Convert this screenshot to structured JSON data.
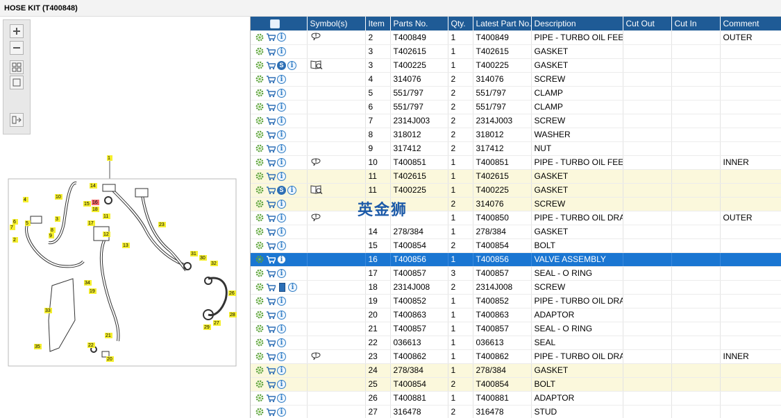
{
  "title": "HOSE KIT (T400848)",
  "toolbar": {
    "buttons": [
      {
        "name": "zoom-in-icon"
      },
      {
        "name": "zoom-out-icon"
      },
      {
        "name": "fit-icon"
      },
      {
        "name": "actual-size-icon"
      },
      {
        "name": "export-icon"
      }
    ]
  },
  "diagram": {
    "callouts": [
      "1",
      "4",
      "10",
      "14",
      "16",
      "15",
      "18",
      "17",
      "11",
      "23",
      "13",
      "5",
      "3",
      "8",
      "9",
      "7",
      "6",
      "2",
      "12",
      "31",
      "30",
      "32",
      "34",
      "19",
      "26",
      "33",
      "28",
      "27",
      "29",
      "21",
      "22",
      "35",
      "20"
    ]
  },
  "watermark": "英金狮",
  "table": {
    "headers": [
      "",
      "Symbol(s)",
      "Item",
      "Parts No.",
      "Qty.",
      "Latest Part No.",
      "Description",
      "Cut Out",
      "Cut In",
      "Comment"
    ],
    "rows": [
      {
        "icons": [
          "gear",
          "cart",
          "info"
        ],
        "symbol": "balloon",
        "item": "2",
        "parts": "T400849",
        "qty": "1",
        "latest": "T400849",
        "desc": "PIPE - TURBO OIL FEED",
        "comment": "OUTER",
        "style": ""
      },
      {
        "icons": [
          "gear",
          "cart",
          "info"
        ],
        "symbol": "",
        "item": "3",
        "parts": "T402615",
        "qty": "1",
        "latest": "T402615",
        "desc": "GASKET",
        "comment": "",
        "style": ""
      },
      {
        "icons": [
          "gear",
          "cart",
          "s",
          "info"
        ],
        "symbol": "book",
        "item": "3",
        "parts": "T400225",
        "qty": "1",
        "latest": "T400225",
        "desc": "GASKET",
        "comment": "",
        "style": ""
      },
      {
        "icons": [
          "gear",
          "cart",
          "info"
        ],
        "symbol": "",
        "item": "4",
        "parts": "314076",
        "qty": "2",
        "latest": "314076",
        "desc": "SCREW",
        "comment": "",
        "style": ""
      },
      {
        "icons": [
          "gear",
          "cart",
          "info"
        ],
        "symbol": "",
        "item": "5",
        "parts": "551/797",
        "qty": "2",
        "latest": "551/797",
        "desc": "CLAMP",
        "comment": "",
        "style": ""
      },
      {
        "icons": [
          "gear",
          "cart",
          "info"
        ],
        "symbol": "",
        "item": "6",
        "parts": "551/797",
        "qty": "2",
        "latest": "551/797",
        "desc": "CLAMP",
        "comment": "",
        "style": ""
      },
      {
        "icons": [
          "gear",
          "cart",
          "info"
        ],
        "symbol": "",
        "item": "7",
        "parts": "2314J003",
        "qty": "2",
        "latest": "2314J003",
        "desc": "SCREW",
        "comment": "",
        "style": ""
      },
      {
        "icons": [
          "gear",
          "cart",
          "info"
        ],
        "symbol": "",
        "item": "8",
        "parts": "318012",
        "qty": "2",
        "latest": "318012",
        "desc": "WASHER",
        "comment": "",
        "style": ""
      },
      {
        "icons": [
          "gear",
          "cart",
          "info"
        ],
        "symbol": "",
        "item": "9",
        "parts": "317412",
        "qty": "2",
        "latest": "317412",
        "desc": "NUT",
        "comment": "",
        "style": ""
      },
      {
        "icons": [
          "gear",
          "cart",
          "info"
        ],
        "symbol": "balloon",
        "item": "10",
        "parts": "T400851",
        "qty": "1",
        "latest": "T400851",
        "desc": "PIPE - TURBO OIL FEED",
        "comment": "INNER",
        "style": ""
      },
      {
        "icons": [
          "gear",
          "cart",
          "info"
        ],
        "symbol": "",
        "item": "11",
        "parts": "T402615",
        "qty": "1",
        "latest": "T402615",
        "desc": "GASKET",
        "comment": "",
        "style": "alt"
      },
      {
        "icons": [
          "gear",
          "cart",
          "s",
          "info"
        ],
        "symbol": "book",
        "item": "11",
        "parts": "T400225",
        "qty": "1",
        "latest": "T400225",
        "desc": "GASKET",
        "comment": "",
        "style": "alt"
      },
      {
        "icons": [
          "gear",
          "cart",
          "info"
        ],
        "symbol": "",
        "item": "",
        "parts": "",
        "qty": "2",
        "latest": "314076",
        "desc": "SCREW",
        "comment": "",
        "style": "alt"
      },
      {
        "icons": [
          "gear",
          "cart",
          "info"
        ],
        "symbol": "balloon",
        "item": "",
        "parts": "",
        "qty": "1",
        "latest": "T400850",
        "desc": "PIPE - TURBO OIL DRAIN",
        "comment": "OUTER",
        "style": ""
      },
      {
        "icons": [
          "gear",
          "cart",
          "info"
        ],
        "symbol": "",
        "item": "14",
        "parts": "278/384",
        "qty": "1",
        "latest": "278/384",
        "desc": "GASKET",
        "comment": "",
        "style": ""
      },
      {
        "icons": [
          "gear",
          "cart",
          "info"
        ],
        "symbol": "",
        "item": "15",
        "parts": "T400854",
        "qty": "2",
        "latest": "T400854",
        "desc": "BOLT",
        "comment": "",
        "style": ""
      },
      {
        "icons": [
          "gear",
          "cart",
          "info"
        ],
        "symbol": "",
        "item": "16",
        "parts": "T400856",
        "qty": "1",
        "latest": "T400856",
        "desc": "VALVE ASSEMBLY",
        "comment": "",
        "style": "selected"
      },
      {
        "icons": [
          "gear",
          "cart",
          "info"
        ],
        "symbol": "",
        "item": "17",
        "parts": "T400857",
        "qty": "3",
        "latest": "T400857",
        "desc": "SEAL - O RING",
        "comment": "",
        "style": ""
      },
      {
        "icons": [
          "gear",
          "cart",
          "book",
          "info"
        ],
        "symbol": "",
        "item": "18",
        "parts": "2314J008",
        "qty": "2",
        "latest": "2314J008",
        "desc": "SCREW",
        "comment": "",
        "style": ""
      },
      {
        "icons": [
          "gear",
          "cart",
          "info"
        ],
        "symbol": "",
        "item": "19",
        "parts": "T400852",
        "qty": "1",
        "latest": "T400852",
        "desc": "PIPE - TURBO OIL DRAIN",
        "comment": "",
        "style": ""
      },
      {
        "icons": [
          "gear",
          "cart",
          "info"
        ],
        "symbol": "",
        "item": "20",
        "parts": "T400863",
        "qty": "1",
        "latest": "T400863",
        "desc": "ADAPTOR",
        "comment": "",
        "style": ""
      },
      {
        "icons": [
          "gear",
          "cart",
          "info"
        ],
        "symbol": "",
        "item": "21",
        "parts": "T400857",
        "qty": "1",
        "latest": "T400857",
        "desc": "SEAL - O RING",
        "comment": "",
        "style": ""
      },
      {
        "icons": [
          "gear",
          "cart",
          "info"
        ],
        "symbol": "",
        "item": "22",
        "parts": "036613",
        "qty": "1",
        "latest": "036613",
        "desc": "SEAL",
        "comment": "",
        "style": ""
      },
      {
        "icons": [
          "gear",
          "cart",
          "info"
        ],
        "symbol": "balloon",
        "item": "23",
        "parts": "T400862",
        "qty": "1",
        "latest": "T400862",
        "desc": "PIPE - TURBO OIL DRAIN",
        "comment": "INNER",
        "style": ""
      },
      {
        "icons": [
          "gear",
          "cart",
          "info"
        ],
        "symbol": "",
        "item": "24",
        "parts": "278/384",
        "qty": "1",
        "latest": "278/384",
        "desc": "GASKET",
        "comment": "",
        "style": "alt"
      },
      {
        "icons": [
          "gear",
          "cart",
          "info"
        ],
        "symbol": "",
        "item": "25",
        "parts": "T400854",
        "qty": "2",
        "latest": "T400854",
        "desc": "BOLT",
        "comment": "",
        "style": "alt"
      },
      {
        "icons": [
          "gear",
          "cart",
          "info"
        ],
        "symbol": "",
        "item": "26",
        "parts": "T400881",
        "qty": "1",
        "latest": "T400881",
        "desc": "ADAPTOR",
        "comment": "",
        "style": ""
      },
      {
        "icons": [
          "gear",
          "cart",
          "info"
        ],
        "symbol": "",
        "item": "27",
        "parts": "316478",
        "qty": "2",
        "latest": "316478",
        "desc": "STUD",
        "comment": "",
        "style": ""
      }
    ]
  }
}
